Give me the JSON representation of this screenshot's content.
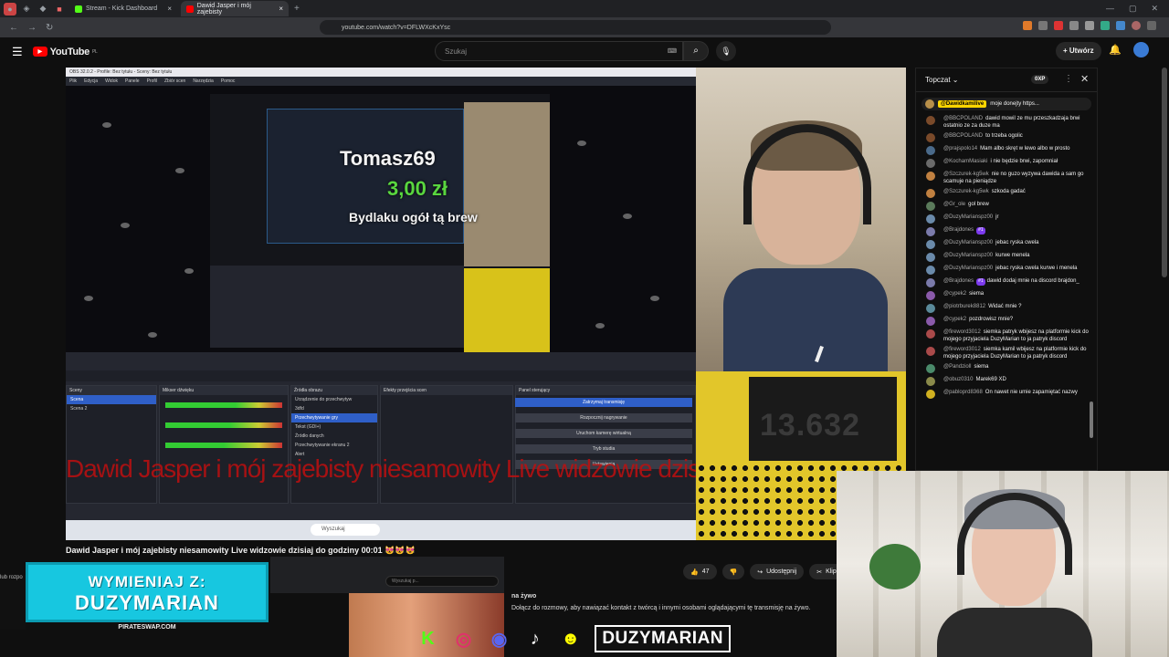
{
  "browser": {
    "tabs": [
      {
        "label": "Stream - Kick Dashboard"
      },
      {
        "label": "Dawid Jasper i mój zajebisty"
      }
    ],
    "url": "youtube.com/watch?v=DFLWXcKxYsc"
  },
  "youtube": {
    "logo_text": "YouTube",
    "region": "PL",
    "search_placeholder": "Szukaj",
    "create_label": "Utwórz"
  },
  "stream": {
    "obs_title": "OBS 32.0.2 - Profile: Bez tytułu - Sceny: Bez tytułu",
    "obs_menu": [
      "Plik",
      "Edycja",
      "Widok",
      "Panele",
      "Profil",
      "Zbiór scen",
      "Narzędzia",
      "Pomoc"
    ],
    "alert_name": "Tomasz69",
    "alert_amount": "3,00 zł",
    "alert_message": "Bydlaku ogół tą brew",
    "counter_value": "13.632",
    "ticker_text": "Dawid Jasper i mój zajebisty niesamowity Live widzowie dzisiaj do godziny 00:01",
    "docks": {
      "sceny": "Sceny",
      "scene_items": [
        "Scena",
        "Scena 2"
      ],
      "mikser": "Mikser dźwięku",
      "zrodla": "Źródła obrazu",
      "source_items": [
        "Urządzenie do przechwytyw",
        "3dfd",
        "Przechwytywanie gry",
        "Tekst (GDI+)",
        "Źródło danych",
        "Przechwytywanie ekranu 2",
        "Alert"
      ],
      "efekty": "Efekty przejścia scen",
      "sterowanie": "Panel sterujący",
      "controls": [
        "Zatrzymaj transmisję",
        "Rozpocznij nagrywanie",
        "Uruchom kamerę wirtualną",
        "Tryb studia",
        "Ustawienia"
      ]
    },
    "taskbar_search": "Wyszukaj"
  },
  "video": {
    "title": "Dawid Jasper i mój zajebisty niesamowity Live widzowie dzisiaj do godziny 00:01 😻😻😻",
    "likes": "47",
    "share_label": "Udostępnij",
    "clip_label": "Klip"
  },
  "chat": {
    "mode_label": "Topczat",
    "xp_label": "0XP",
    "pinned_author": "@Dawidkamilive",
    "pinned_text": "moje donejty https...",
    "messages": [
      {
        "author": "@BBCPOLAND",
        "text": "dawid mowil ze mu przeszkadzaja brwi ostatnio ze za duze ma",
        "color": "#7a4a2a"
      },
      {
        "author": "@BBCPOLAND",
        "text": "to trzeba ogolic",
        "color": "#7a4a2a"
      },
      {
        "author": "@prajspolo14",
        "text": "Mam albo skręt w lewo albo w prosto",
        "color": "#4a6a8a"
      },
      {
        "author": "@KochamMasiaki",
        "text": "i nie będzie brwi, zapomniał",
        "color": "#6a6a6a"
      },
      {
        "author": "@Szczurek-kg5wk",
        "text": "nie no guzo wyzywa dawida a sam go scamuje na pieniądze",
        "color": "#c08040"
      },
      {
        "author": "@Szczurek-kg5wk",
        "text": "szkoda gadać",
        "color": "#c08040"
      },
      {
        "author": "@Gr_ole",
        "text": "gol brew",
        "color": "#5a7a5a"
      },
      {
        "author": "@DuzyMarianspz00",
        "text": "jr",
        "color": "#6a8aaa"
      },
      {
        "author": "@Brajdones",
        "text": "",
        "badge": "#1",
        "color": "#7a7aaa"
      },
      {
        "author": "@DuzyMarianspz00",
        "text": "jebac ryska cwela",
        "color": "#6a8aaa"
      },
      {
        "author": "@DuzyMarianspz00",
        "text": "kurwe menela",
        "color": "#6a8aaa"
      },
      {
        "author": "@DuzyMarianspz00",
        "text": "jebac ryska cwela kurwe i menela",
        "color": "#6a8aaa"
      },
      {
        "author": "@Brajdones",
        "text": "dawid dodaj mnie na discord brajdon_",
        "badge": "#1",
        "color": "#7a7aaa"
      },
      {
        "author": "@cypek2",
        "text": "siema",
        "color": "#8a5aaa"
      },
      {
        "author": "@piotrburek8812",
        "text": "Widać mnie ?",
        "color": "#5a8a9a"
      },
      {
        "author": "@cypek2",
        "text": "pozdrowisz mnie?",
        "color": "#8a5aaa"
      },
      {
        "author": "@fireword3012",
        "text": "siemka patryk wbijesz na platformie kick do mojego przyjaciela DuzyMarian to ja patryk discord",
        "color": "#aa4a4a"
      },
      {
        "author": "@fireword3012",
        "text": "siemka kamil wbijesz na platformie kick do mojego przyjaciela DuzyMarian to ja patryk discord",
        "color": "#aa4a4a"
      },
      {
        "author": "@Pandzioll",
        "text": "siema",
        "color": "#4a8a6a"
      },
      {
        "author": "@obuz0310",
        "text": "Marek69 XD",
        "color": "#8a8a4a"
      },
      {
        "author": "@pabloprd8368",
        "text": "On nawet nie umie zapamiętać nazwy",
        "color": "#d0b020"
      }
    ]
  },
  "overlay": {
    "promo_line1": "WYMIENIAJ Z:",
    "promo_line2": "DUZYMARIAN",
    "promo_footer": "PIRATESWAP.COM",
    "brand_tag": "DUZYMARIAN",
    "mini_search": "Wyszukaj p...",
    "join_title": "na żywo",
    "join_text": "Dołącz do rozmowy, aby nawiązać kontakt z twórcą i innymi osobami oglądającymi tę transmisję na żywo.",
    "left_strip_text": "lub rozpo"
  }
}
